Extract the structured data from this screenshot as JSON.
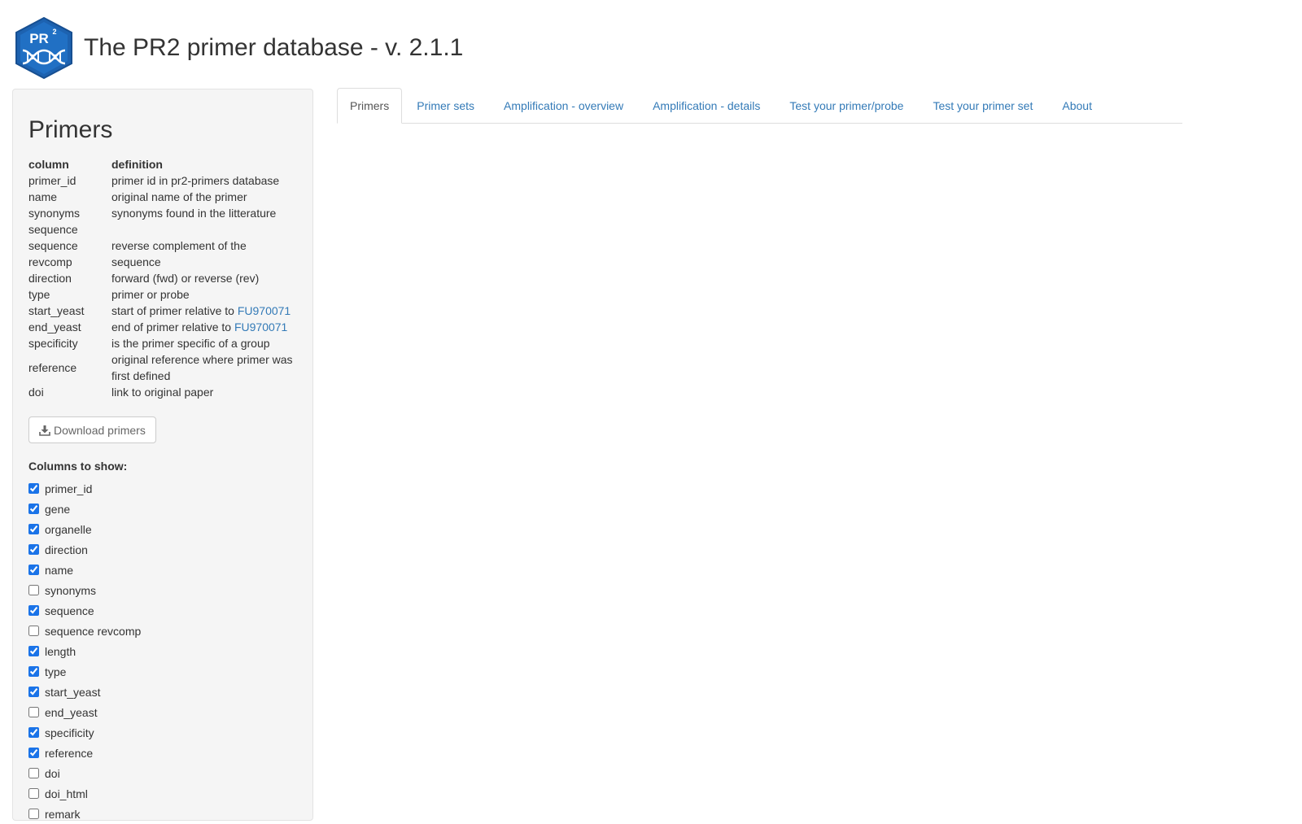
{
  "header": {
    "title": "The PR2 primer database - v. 2.1.1",
    "logo_text": "PR2"
  },
  "tabs": [
    {
      "label": "Primers",
      "active": true
    },
    {
      "label": "Primer sets"
    },
    {
      "label": "Amplification - overview"
    },
    {
      "label": "Amplification - details"
    },
    {
      "label": "Test your primer/probe"
    },
    {
      "label": "Test your primer set"
    },
    {
      "label": "About"
    }
  ],
  "sidebar": {
    "title": "Primers",
    "table": {
      "headers": [
        "column",
        "definition"
      ],
      "rows": [
        {
          "col": "primer_id",
          "def": "primer id in pr2-primers database"
        },
        {
          "col": "name",
          "def": "original name of the primer"
        },
        {
          "col": "synonyms",
          "def": "synonyms found in the litterature"
        },
        {
          "col": "sequence",
          "def": ""
        },
        {
          "col": "sequence revcomp",
          "def": "reverse complement of the sequence"
        },
        {
          "col": "direction",
          "def": "forward (fwd) or reverse (rev)"
        },
        {
          "col": "type",
          "def": "primer or probe"
        },
        {
          "col": "start_yeast",
          "def": "start of primer relative to ",
          "link": "FU970071"
        },
        {
          "col": "end_yeast",
          "def": "end of primer relative to ",
          "link": "FU970071"
        },
        {
          "col": "specificity",
          "def": "is the primer specific of a group"
        },
        {
          "col": "reference",
          "def": "original reference where primer was first defined"
        },
        {
          "col": "doi",
          "def": "link to original paper"
        }
      ]
    },
    "download_label": "Download primers",
    "columns_label": "Columns to show:",
    "columns": [
      {
        "label": "primer_id",
        "checked": true
      },
      {
        "label": "gene",
        "checked": true
      },
      {
        "label": "organelle",
        "checked": true
      },
      {
        "label": "direction",
        "checked": true
      },
      {
        "label": "name",
        "checked": true
      },
      {
        "label": "synonyms",
        "checked": false
      },
      {
        "label": "sequence",
        "checked": true
      },
      {
        "label": "sequence revcomp",
        "checked": false
      },
      {
        "label": "length",
        "checked": true
      },
      {
        "label": "type",
        "checked": true
      },
      {
        "label": "start_yeast",
        "checked": true
      },
      {
        "label": "end_yeast",
        "checked": false
      },
      {
        "label": "specificity",
        "checked": true
      },
      {
        "label": "reference",
        "checked": true
      },
      {
        "label": "doi",
        "checked": false
      },
      {
        "label": "doi_html",
        "checked": false
      },
      {
        "label": "remark",
        "checked": false
      }
    ]
  },
  "colors": {
    "link": "#337ab7",
    "logo_blue": "#1f5fa8",
    "logo_light": "#2b7fd4"
  }
}
